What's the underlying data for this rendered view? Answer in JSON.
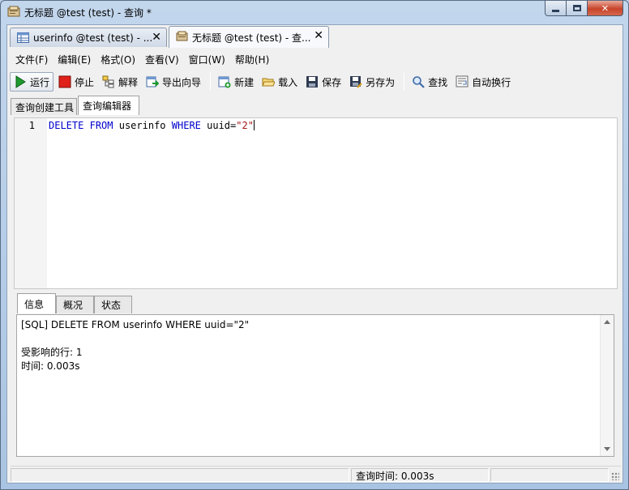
{
  "window": {
    "title": "无标题 @test (test) - 查询 *",
    "icon": "query-app-icon"
  },
  "doc_tabs": [
    {
      "label": "userinfo @test (test) - ...",
      "icon": "table-icon",
      "active": false
    },
    {
      "label": "无标题 @test (test) - 查...",
      "icon": "query-icon",
      "active": true
    }
  ],
  "menu": [
    {
      "label": "文件(F)"
    },
    {
      "label": "编辑(E)"
    },
    {
      "label": "格式(O)"
    },
    {
      "label": "查看(V)"
    },
    {
      "label": "窗口(W)"
    },
    {
      "label": "帮助(H)"
    }
  ],
  "toolbar": {
    "run": "运行",
    "stop": "停止",
    "explain": "解释",
    "export_wizard": "导出向导",
    "new": "新建",
    "load": "载入",
    "save": "保存",
    "save_as": "另存为",
    "find": "查找",
    "word_wrap": "自动换行"
  },
  "editor_tabs": [
    {
      "label": "查询创建工具",
      "active": false
    },
    {
      "label": "查询编辑器",
      "active": true
    }
  ],
  "editor": {
    "line_number": "1",
    "kw1": "DELETE",
    "kw2": "FROM",
    "table": "userinfo",
    "kw3": "WHERE",
    "condition": "uuid=",
    "value": "\"2\""
  },
  "result_tabs": [
    {
      "label": "信息",
      "active": true
    },
    {
      "label": "概况",
      "active": false
    },
    {
      "label": "状态",
      "active": false
    }
  ],
  "result": {
    "sql_line": "[SQL] DELETE FROM userinfo WHERE uuid=\"2\"",
    "affected": "受影响的行: 1",
    "time": "时间: 0.003s"
  },
  "status": {
    "query_time": "查询时间: 0.003s"
  },
  "colors": {
    "keyword": "#0000cc",
    "string": "#a31515",
    "stop_red": "#e0201a",
    "run_green": "#1e9b2e"
  }
}
